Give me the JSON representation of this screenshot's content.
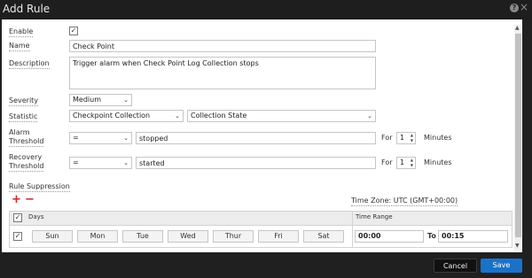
{
  "window": {
    "title": "Add Rule",
    "help_icon": "?",
    "close_icon": "×"
  },
  "form": {
    "enable_label": "Enable",
    "enable_checked": true,
    "name_label": "Name",
    "name_value": "Check Point",
    "description_label": "Description",
    "description_value": "Trigger alarm when Check Point Log Collection stops",
    "severity_label": "Severity",
    "severity_value": "Medium",
    "statistic_label": "Statistic",
    "statistic_source_value": "Checkpoint Collection",
    "statistic_metric_value": "Collection State",
    "alarm_threshold_label_1": "Alarm",
    "alarm_threshold_label_2": "Threshold",
    "alarm_operator": "=",
    "alarm_value": "stopped",
    "alarm_for_label": "For",
    "alarm_for_value": "1",
    "alarm_unit": "Minutes",
    "recovery_threshold_label_1": "Recovery",
    "recovery_threshold_label_2": "Threshold",
    "recovery_operator": "=",
    "recovery_value": "started",
    "recovery_for_label": "For",
    "recovery_for_value": "1",
    "recovery_unit": "Minutes",
    "rule_suppression_label": "Rule Suppression",
    "timezone_label": "Time Zone: UTC (GMT+00:00)"
  },
  "suppression_table": {
    "header_days": "Days",
    "header_time_range": "Time Range",
    "days": [
      "Sun",
      "Mon",
      "Tue",
      "Wed",
      "Thur",
      "Fri",
      "Sat"
    ],
    "from_value": "00:00",
    "to_label": "To",
    "to_value": "00:15"
  },
  "footer": {
    "cancel_label": "Cancel",
    "save_label": "Save"
  },
  "colors": {
    "accent": "#1a73c9",
    "danger": "#d32222",
    "titlebar": "#1e1e1e"
  }
}
